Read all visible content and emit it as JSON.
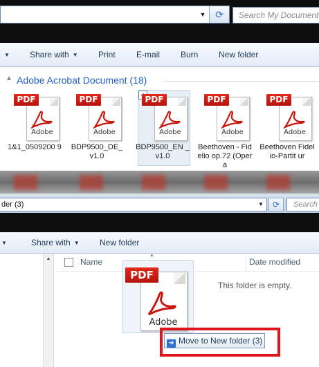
{
  "top_window": {
    "search_placeholder": "Search My Documents",
    "toolbar": {
      "share_with": "Share with",
      "print": "Print",
      "email": "E-mail",
      "burn": "Burn",
      "new_folder": "New folder"
    },
    "group_header": "Adobe Acrobat Document (18)",
    "files": [
      {
        "name": "1&1_0509200 9",
        "selected": false
      },
      {
        "name": "BDP9500_DE_ v1.0",
        "selected": false
      },
      {
        "name": "BDP9500_EN _v1.0",
        "selected": true
      },
      {
        "name": "Beethoven - Fidelio op.72 (Opera",
        "selected": false
      },
      {
        "name": "Beethoven Fidelio-Partit ur",
        "selected": false
      }
    ]
  },
  "bottom_window": {
    "address_text": "der (3)",
    "search_placeholder": "Search",
    "toolbar": {
      "share_with": "Share with",
      "new_folder": "New folder"
    },
    "columns": {
      "name": "Name",
      "date_modified": "Date modified"
    },
    "empty_message": "This folder is empty.",
    "drag_tooltip": "Move to New folder (3)",
    "drag_icon_tag": "PDF",
    "drag_icon_brand": "Adobe"
  },
  "icons": {
    "pdf_tag": "PDF",
    "pdf_brand": "Adobe"
  },
  "colors": {
    "highlight_box": "#e0141c",
    "group_header": "#1e5ec9",
    "pdf_red": "#c8160e"
  }
}
